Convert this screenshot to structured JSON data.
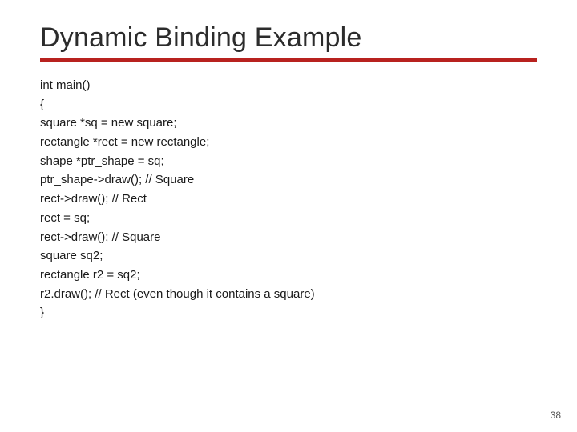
{
  "title": "Dynamic Binding Example",
  "code": {
    "l0": "int main()",
    "l1": "{",
    "l2": "square *sq = new square;",
    "l3": "rectangle *rect = new rectangle;",
    "l4": "shape *ptr_shape = sq;",
    "l5": "ptr_shape->draw(); // Square",
    "l6": "rect->draw(); // Rect",
    "l7": "rect = sq;",
    "l8": "rect->draw(); // Square",
    "l9": "square sq2;",
    "l10": "rectangle r2 = sq2;",
    "l11": "r2.draw(); // Rect (even though it contains a square)",
    "l12": "}"
  },
  "page_number": "38"
}
